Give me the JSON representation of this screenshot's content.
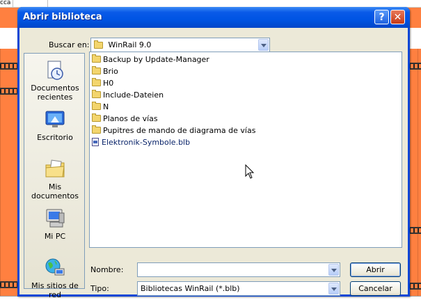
{
  "background": {
    "top_cell_text": "cca"
  },
  "dialog": {
    "title": "Abrir biblioteca",
    "help_label": "?",
    "close_label": "✕",
    "look_in_label": "Buscar en:",
    "look_in_value": "WinRail 9.0",
    "places": [
      {
        "label": "Documentos recientes",
        "icon": "recent-documents-icon"
      },
      {
        "label": "Escritorio",
        "icon": "desktop-icon"
      },
      {
        "label": "Mis documentos",
        "icon": "my-documents-icon"
      },
      {
        "label": "Mi PC",
        "icon": "my-computer-icon"
      },
      {
        "label": "Mis sitios de red",
        "icon": "network-places-icon"
      }
    ],
    "files": [
      {
        "name": "Backup by Update-Manager",
        "type": "folder"
      },
      {
        "name": "Brio",
        "type": "folder"
      },
      {
        "name": "H0",
        "type": "folder"
      },
      {
        "name": "Include-Dateien",
        "type": "folder"
      },
      {
        "name": "N",
        "type": "folder"
      },
      {
        "name": "Planos de vías",
        "type": "folder"
      },
      {
        "name": "Pupitres de mando de diagrama de vías",
        "type": "folder"
      },
      {
        "name": "Elektronik-Symbole.blb",
        "type": "file"
      }
    ],
    "filename_label": "Nombre:",
    "filename_value": "",
    "filetype_label": "Tipo:",
    "filetype_value": "Bibliotecas WinRail (*.blb)",
    "open_label": "Abrir",
    "cancel_label": "Cancelar",
    "colors": {
      "titlebar": "#0054e3",
      "dialog_face": "#ece9d8",
      "app_background": "#ff8040"
    }
  }
}
